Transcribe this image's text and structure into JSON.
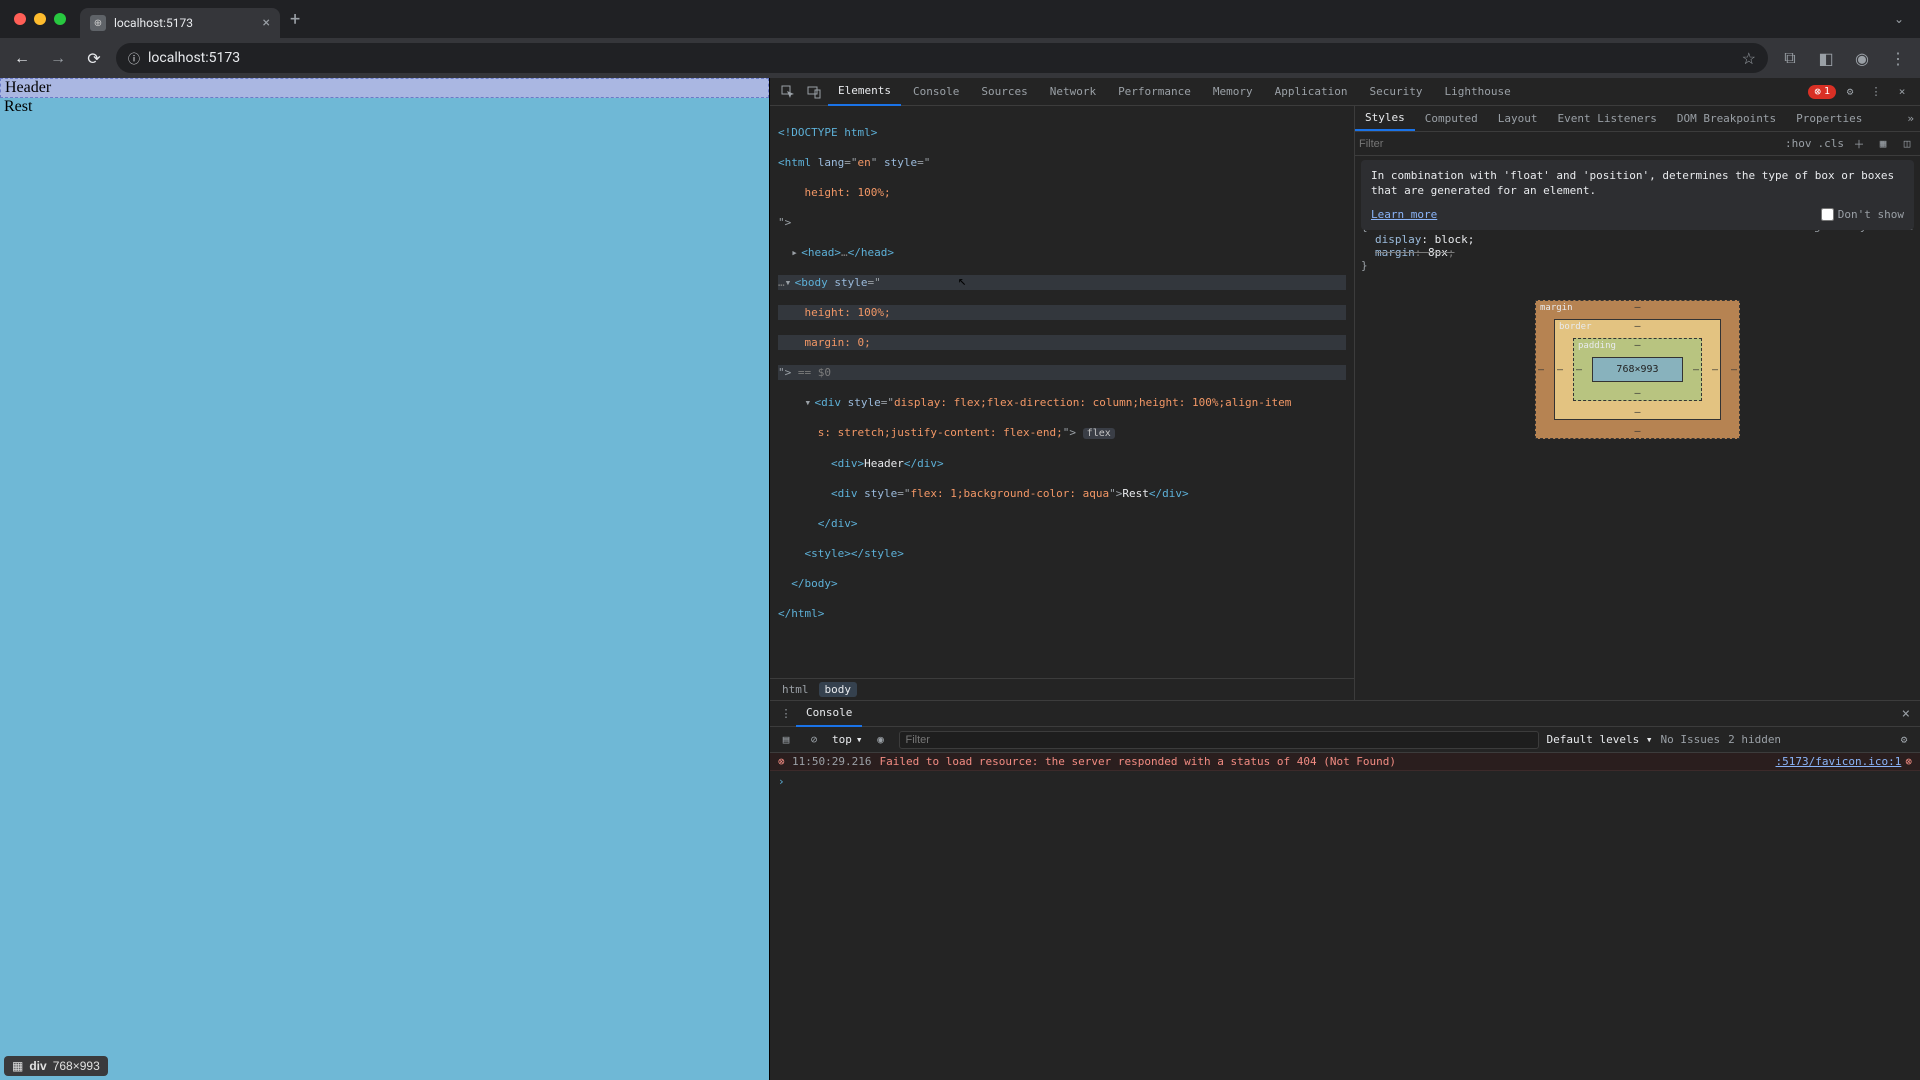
{
  "browser": {
    "tab_title": "localhost:5173",
    "url_display": "localhost:5173",
    "url_scheme_icon": "ⓘ"
  },
  "page": {
    "header_text": "Header",
    "rest_text": "Rest",
    "status_tag": "div",
    "status_dims": "768×993"
  },
  "devtools": {
    "tabs": [
      "Elements",
      "Console",
      "Sources",
      "Network",
      "Performance",
      "Memory",
      "Application",
      "Security",
      "Lighthouse"
    ],
    "active_tab": "Elements",
    "error_count": "1"
  },
  "dom": {
    "l1": "<!DOCTYPE html>",
    "l2a": "<html ",
    "l2b": "lang",
    "l2c": "=\"",
    "l2d": "en",
    "l2e": "\" ",
    "l2f": "style",
    "l2g": "=\"",
    "l3": "    height: 100%;",
    "l4": "\">",
    "l5a": "<head>",
    "l5b": "…",
    "l5c": "</head>",
    "l6a": "<body ",
    "l6b": "style",
    "l6c": "=\"",
    "l7": "    height: 100%;",
    "l8": "    margin: 0;",
    "l9a": "\"> ",
    "l9b": "== $0",
    "l10a": "<div ",
    "l10b": "style",
    "l10c": "=\"",
    "l10d": "display: flex;flex-direction: column;height: 100%;align-item",
    "l11a": "s: stretch;justify-content: flex-end;",
    "l11b": "\"> ",
    "l11pill": "flex",
    "l12a": "<div>",
    "l12b": "Header",
    "l12c": "</div>",
    "l13a": "<div ",
    "l13b": "style",
    "l13c": "=\"",
    "l13d": "flex: 1;background-color: aqua",
    "l13e": "\">",
    "l13f": "Rest",
    "l13g": "</div>",
    "l14": "</div>",
    "l15a": "<style>",
    "l15b": "</style>",
    "l16": "</body>",
    "l17": "</html>",
    "breadcrumb": [
      "html",
      "body"
    ]
  },
  "styles": {
    "tabs": [
      "Styles",
      "Computed",
      "Layout",
      "Event Listeners",
      "DOM Breakpoints",
      "Properties"
    ],
    "filter_placeholder": "Filter",
    "hov": ":hov",
    "cls": ".cls",
    "tooltip_text": "In combination with 'float' and 'position', determines the type of box or boxes that are generated for an element.",
    "learn_more": "Learn more",
    "dont_show": "Don't show",
    "rule_source": "user agent stylesheet",
    "rule_selector_open": "{",
    "rule_prop1": "display",
    "rule_val1": "block",
    "rule_prop2": "margin",
    "rule_val2": "8px",
    "rule_close": "}",
    "box": {
      "margin": "margin",
      "border": "border",
      "padding": "padding",
      "dash": "–",
      "content": "768×993"
    }
  },
  "drawer": {
    "tab": "Console",
    "context": "top",
    "filter_placeholder": "Filter",
    "levels": "Default levels",
    "no_issues": "No Issues",
    "hidden": "2 hidden"
  },
  "console_msg": {
    "time": "11:50:29.216",
    "text": "Failed to load resource: the server responded with a status of 404 (Not Found)",
    "source": ":5173/favicon.ico:1"
  }
}
